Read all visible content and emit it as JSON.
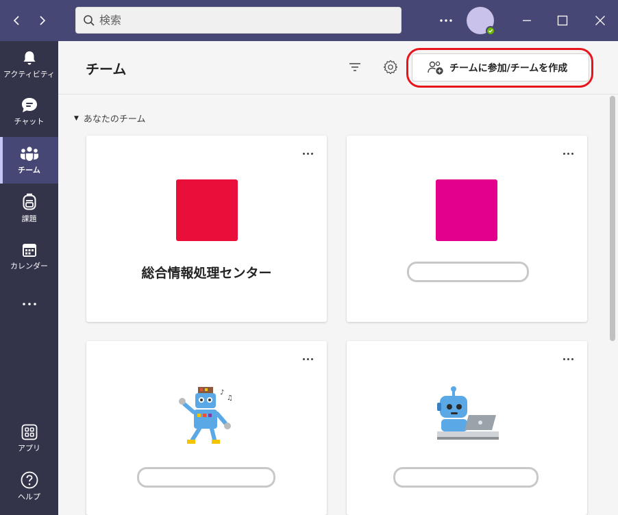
{
  "search": {
    "placeholder": "検索"
  },
  "rail": {
    "items": [
      {
        "label": "アクティビティ",
        "icon": "bell-icon"
      },
      {
        "label": "チャット",
        "icon": "chat-icon"
      },
      {
        "label": "チーム",
        "icon": "teams-icon",
        "active": true
      },
      {
        "label": "課題",
        "icon": "backpack-icon"
      },
      {
        "label": "カレンダー",
        "icon": "calendar-icon"
      },
      {
        "label": "アプリ",
        "icon": "apps-icon"
      },
      {
        "label": "ヘルプ",
        "icon": "help-icon"
      }
    ]
  },
  "header": {
    "title": "チーム",
    "join_button": "チームに参加/チームを作成"
  },
  "section": {
    "label": "あなたのチーム"
  },
  "teams": [
    {
      "name": "総合情報処理センター",
      "tile_color": "#ea0f3b"
    },
    {
      "name": "",
      "tile_color": "#e3008c"
    },
    {
      "name": "",
      "icon": "dancing-robot-icon"
    },
    {
      "name": "",
      "icon": "laptop-robot-icon"
    }
  ],
  "colors": {
    "titlebar": "#464775",
    "rail": "#33344a",
    "highlight": "#e8141c"
  }
}
